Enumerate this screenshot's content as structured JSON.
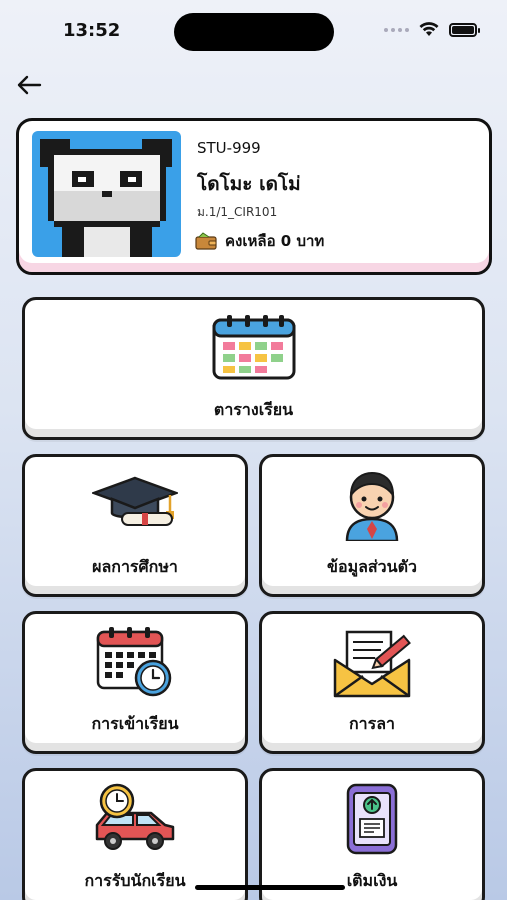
{
  "status_bar": {
    "time": "13:52"
  },
  "profile": {
    "student_id": "STU-999",
    "name": "โดโมะ เดโม่",
    "class": "ม.1/1_CIR101",
    "balance": "คงเหลือ 0 บาท",
    "avatar_icon": "pixel-panda-icon"
  },
  "menu": {
    "timetable": "ตารางเรียน",
    "grades": "ผลการศึกษา",
    "personal_info": "ข้อมูลส่วนตัว",
    "attendance": "การเข้าเรียน",
    "leave": "การลา",
    "pickup": "การรับนักเรียน",
    "topup": "เติมเงิน"
  },
  "colors": {
    "card_border": "#111111",
    "profile_accent": "#f7d6e4",
    "avatar_bg": "#3aa0e8"
  }
}
